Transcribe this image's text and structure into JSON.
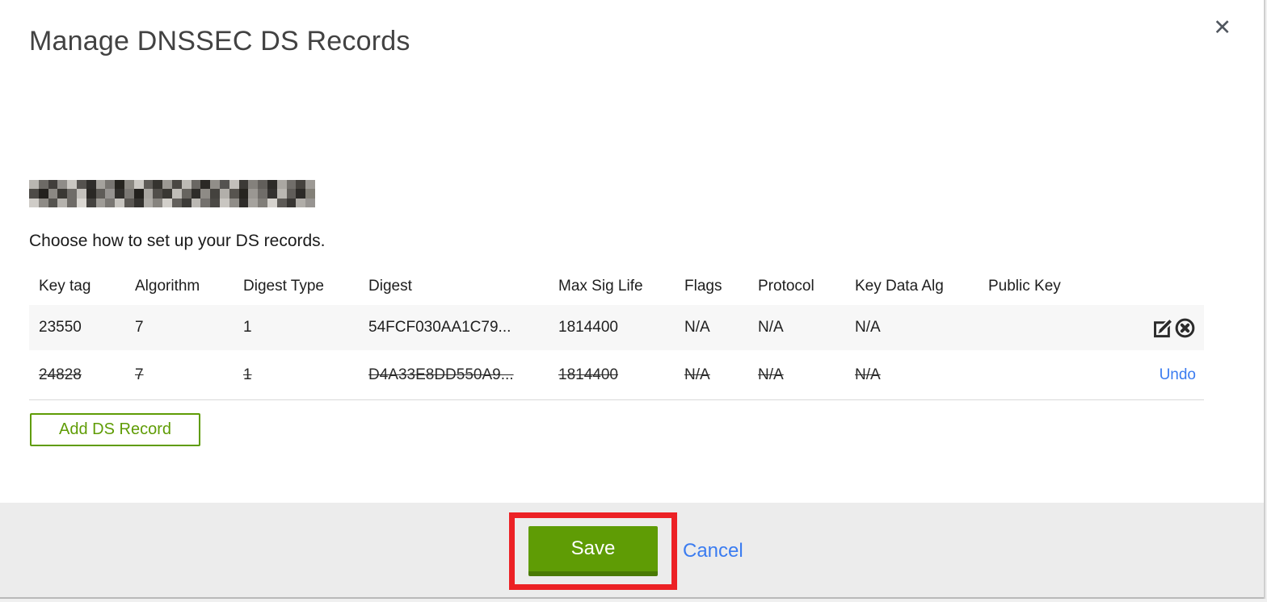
{
  "modal": {
    "title": "Manage DNSSEC DS Records",
    "close_glyph": "✕"
  },
  "domain": {
    "redacted": true,
    "mosaic_cols": 30,
    "mosaic_colors": [
      [
        "#b9b6b1",
        "#6d6a66",
        "#413e3b",
        "#8f8c88",
        "#c9c6c1",
        "#55524f",
        "#2f2d2b",
        "#a5a29d",
        "#787571",
        "#26241f",
        "#8a8781",
        "#cbc8c3",
        "#5e5b57",
        "#35332f",
        "#9b9893",
        "#4a4743",
        "#bdbab5",
        "#6a6763",
        "#2b2926",
        "#918e89",
        "#545250",
        "#c2bfba",
        "#3c3a36",
        "#84817c",
        "#625f5b",
        "#2d2b28",
        "#aaa7a2",
        "#716e6a",
        "#45423e",
        "#9d9a95"
      ],
      [
        "#4e4b47",
        "#23211e",
        "#8b8883",
        "#3a3834",
        "#6f6c68",
        "#c4c1bc",
        "#2a2825",
        "#5f5c58",
        "#969390",
        "#312f2c",
        "#7b7874",
        "#22201d",
        "#a8a5a0",
        "#514e4a",
        "#393733",
        "#c0bdb8",
        "#67645f",
        "#2e2c29",
        "#8e8b86",
        "#44423e",
        "#b2afaa",
        "#57544f",
        "#26241f",
        "#9a9792",
        "#706d69",
        "#343230",
        "#bab7b2",
        "#605d59",
        "#2c2a27",
        "#838078"
      ],
      [
        "#cfccc7",
        "#8e8b86",
        "#55534f",
        "#b5b2ad",
        "#6e6b67",
        "#dbd8d3",
        "#44423f",
        "#9f9c97",
        "#7a7773",
        "#c7c4bf",
        "#5a5753",
        "#34322f",
        "#aeaba6",
        "#87847f",
        "#d2cfca",
        "#63605c",
        "#3d3b38",
        "#bbb8b3",
        "#74716d",
        "#4b4945",
        "#c9c6c1",
        "#908d88",
        "#2f2d2a",
        "#a6a39e",
        "#817e79",
        "#d6d3ce",
        "#5e5b57",
        "#383633",
        "#b0ada8",
        "#979491"
      ]
    ]
  },
  "instruction": "Choose how to set up your DS records.",
  "table": {
    "columns": [
      "Key tag",
      "Algorithm",
      "Digest Type",
      "Digest",
      "Max Sig Life",
      "Flags",
      "Protocol",
      "Key Data Alg",
      "Public Key"
    ],
    "rows": [
      {
        "key_tag": "23550",
        "algorithm": "7",
        "digest_type": "1",
        "digest": "54FCF030AA1C79...",
        "max_sig_life": "1814400",
        "flags": "N/A",
        "protocol": "N/A",
        "key_data_alg": "N/A",
        "public_key": "",
        "state": "active"
      },
      {
        "key_tag": "24828",
        "algorithm": "7",
        "digest_type": "1",
        "digest": "D4A33E8DD550A9...",
        "max_sig_life": "1814400",
        "flags": "N/A",
        "protocol": "N/A",
        "key_data_alg": "N/A",
        "public_key": "",
        "state": "deleted",
        "undo_label": "Undo"
      }
    ]
  },
  "actions": {
    "add_ds_record": "Add DS Record",
    "save": "Save",
    "cancel": "Cancel"
  },
  "colors": {
    "accent_green": "#5f9c05",
    "accent_green_dark": "#4a7a04",
    "link_blue": "#3b7cf0",
    "annotation_red": "#ec2125",
    "row_highlight": "#f7f7f7",
    "footer_gray": "#ececec",
    "icon_dark": "#2b2b2b"
  }
}
